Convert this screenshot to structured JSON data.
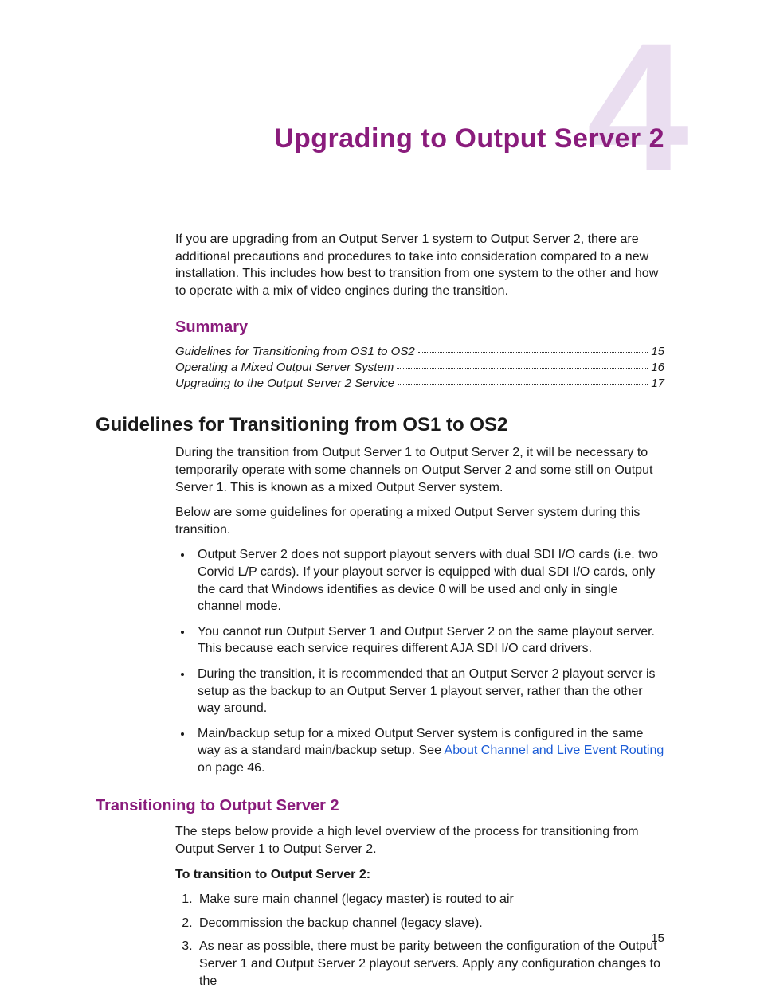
{
  "chapter": {
    "number": "4",
    "title": "Upgrading to Output Server 2"
  },
  "intro": "If you are upgrading from an Output Server 1 system to Output Server 2, there are additional precautions and procedures to take into consideration compared to a new installation. This includes how best to transition from one system to the other and how to operate with a mix of video engines during the transition.",
  "summary": {
    "heading": "Summary",
    "items": [
      {
        "title": "Guidelines for Transitioning from OS1 to OS2",
        "page": "15"
      },
      {
        "title": "Operating a Mixed Output Server System",
        "page": "16"
      },
      {
        "title": "Upgrading to the Output Server 2 Service",
        "page": "17"
      }
    ]
  },
  "section1": {
    "heading": "Guidelines for Transitioning from OS1 to OS2",
    "p1": "During the transition from Output Server 1 to Output Server 2, it will be necessary to temporarily operate with some channels on Output Server 2 and some still on Output Server 1. This is known as a mixed Output Server system.",
    "p2": "Below are some guidelines for operating a mixed Output Server system during this transition.",
    "bullets": [
      "Output Server 2 does not support playout servers with dual SDI I/O cards (i.e. two Corvid L/P cards). If your playout server is equipped with dual SDI I/O cards, only the card that Windows identifies as device 0 will be used and only in single channel mode.",
      "You cannot run Output Server 1 and Output Server 2 on the same playout server. This because each service requires different AJA SDI I/O card drivers.",
      "During the transition, it is recommended that an Output Server 2 playout server is setup as the backup to an Output Server 1 playout server, rather than the other way around."
    ],
    "bullet4_pre": "Main/backup setup for a mixed Output Server system is configured in the same way as a standard main/backup setup. See ",
    "bullet4_link": "About Channel and Live Event Routing",
    "bullet4_post": " on page 46."
  },
  "section2": {
    "heading": "Transitioning to Output Server 2",
    "p1": "The steps below provide a high level overview of the process for transitioning from Output Server 1 to Output Server 2.",
    "runin": "To transition to Output Server 2:",
    "steps": [
      "Make sure main channel (legacy master) is routed to air",
      "Decommission the backup channel (legacy slave).",
      "As near as possible, there must be parity between the configuration of the Output Server 1 and Output Server 2 playout servers. Apply any configuration changes to the"
    ]
  },
  "pageNumber": "15"
}
